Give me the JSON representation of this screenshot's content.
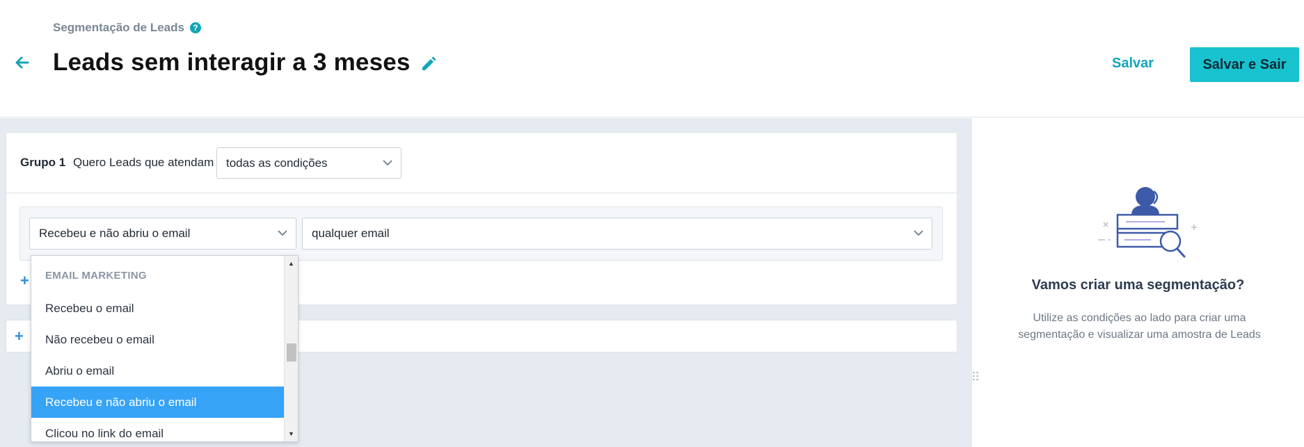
{
  "header": {
    "breadcrumb": "Segmentação de Leads",
    "title": "Leads sem interagir a 3 meses",
    "save_label": "Salvar",
    "save_exit_label": "Salvar e Sair"
  },
  "group": {
    "label": "Grupo 1",
    "prefix_text": "Quero Leads que atendam",
    "condition_mode": "todas as condições"
  },
  "condition_row": {
    "field_value": "Recebeu e não abriu o email",
    "value_select": "qualquer email"
  },
  "dropdown": {
    "group_label": "EMAIL MARKETING",
    "options": [
      {
        "label": "Recebeu o email",
        "selected": false
      },
      {
        "label": "Não recebeu o email",
        "selected": false
      },
      {
        "label": "Abriu o email",
        "selected": false
      },
      {
        "label": "Recebeu e não abriu o email",
        "selected": true
      },
      {
        "label": "Clicou no link do email",
        "selected": false
      }
    ]
  },
  "right_panel": {
    "heading": "Vamos criar uma segmentação?",
    "description": "Utilize as condições ao lado para criar uma segmentação e visualizar uma amostra de Leads"
  },
  "colors": {
    "accent": "#12a5b6",
    "primary_button": "#19c2cf",
    "selected_option": "#36a3f7",
    "workspace_bg": "#e6eaf1"
  },
  "icons": [
    "help-icon",
    "back-arrow-icon",
    "pencil-icon",
    "chevron-down-icon",
    "plus-icon",
    "segmentation-illustration"
  ]
}
